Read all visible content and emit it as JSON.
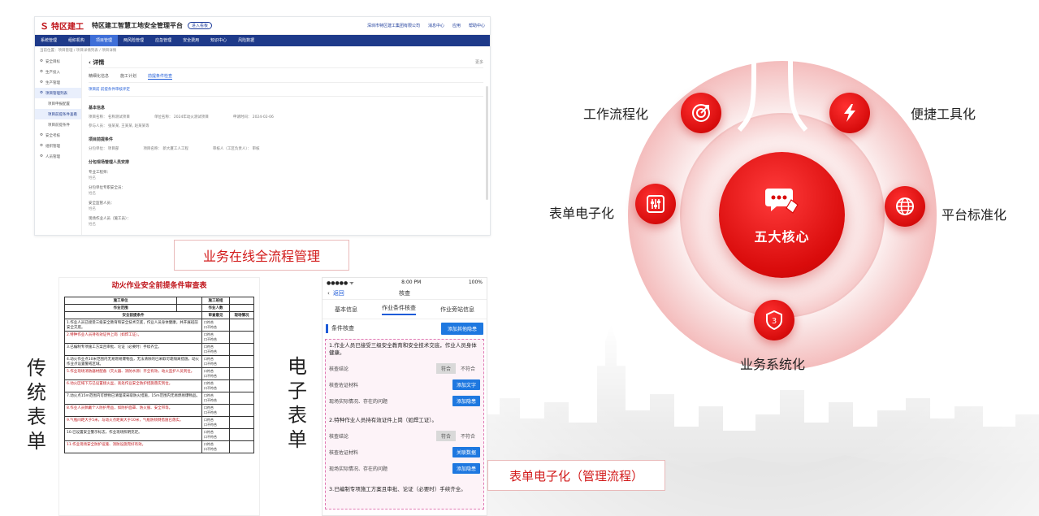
{
  "desktop": {
    "logo_text": "特区建工",
    "app_title": "特区建工智慧工地安全管理平台",
    "pill": "进入看板",
    "org": "深圳市特区建工集团有限公司",
    "top_links": [
      "消息中心",
      "应用",
      "帮助中心"
    ],
    "nav": [
      "系统管理",
      "组织机构",
      "项目管理",
      "两风险管理",
      "应急管理",
      "安全费用",
      "知识中心",
      "风险数据"
    ],
    "nav_active_index": 2,
    "breadcrumb": "当前位置：项目管理 / 项目详情列表 / 项目详情",
    "sidebar": [
      {
        "label": "安全目标",
        "sub": false
      },
      {
        "label": "生产投入",
        "sub": false
      },
      {
        "label": "生产管理",
        "sub": false
      },
      {
        "label": "项目管理列表",
        "sub": false,
        "active": true
      },
      {
        "label": "项目申报配置",
        "sub": true
      },
      {
        "label": "项目前提条件查看",
        "sub": true,
        "active_sub": true
      },
      {
        "label": "项目前提条件",
        "sub": true
      },
      {
        "label": "安全考核",
        "sub": false
      },
      {
        "label": "组织管理",
        "sub": false
      },
      {
        "label": "人员管理",
        "sub": false
      }
    ],
    "detail_title": "详情",
    "detail_more": "更多",
    "tabs": [
      "精细化信息",
      "施工计划",
      "前提条件检查"
    ],
    "tabs_active_index": 2,
    "sub_link": "项目前 前提条件审核评定",
    "section1": "基本信息",
    "row1": [
      "项目名称：   名称测试项目",
      "单位名称：   2024年动火测试项目",
      "申请时间：   2024-02-06"
    ],
    "row2": [
      "参与人员：   张某某, 王某某, 赵某某等"
    ],
    "section2": "项目前提条件",
    "row3": [
      "分包单位：   项目部",
      "项目名称：   新大厦工人工程",
      "审核人（工区负责人）：   审核"
    ],
    "section3": "分包现场管理人员安排",
    "fields": [
      {
        "label": "专业工程师：",
        "value": "姓名"
      },
      {
        "label": "分包单位专职安全员：",
        "value": "姓名"
      },
      {
        "label": "安全监管人员：",
        "value": "姓名"
      },
      {
        "label": "现场作业人员（施工员）：",
        "value": "姓名"
      }
    ]
  },
  "label_top": "业务在线全流程管理",
  "label_traditional": [
    "传",
    "统",
    "表",
    "单"
  ],
  "label_electronic": [
    "电",
    "子",
    "表",
    "单"
  ],
  "label_mobile": "表单电子化（管理流程）",
  "form": {
    "title": "动火作业安全前提条件审查表",
    "h_unit": "施工单位",
    "h_leader": "施工班组",
    "h_area": "作业范围",
    "h_people": "作业人数",
    "h_condition": "安全前提条件",
    "h_check": "审查意见",
    "h_site": "现场情况",
    "check_yes": "口符合",
    "check_no": "口不符合",
    "rows": [
      {
        "text": "1.作业人员已接受三级安全教育和安全技术交底，作业人员身体健康，并开展班前安全交底。",
        "red": false
      },
      {
        "text": "2.特种作业人员持有效证件上岗（如焊工证）。",
        "red": true
      },
      {
        "text": "3.已编制专项施工方案且审批、论证（必要时）手续齐全。",
        "red": false
      },
      {
        "text": "4.动火作业点10米范围内无易燃易爆物品，无法清除的已采取可靠隔离措施，动火作业点设置警戒区域。",
        "red": false
      },
      {
        "text": "5.作业现场消防器材配备（灭火器、消防水源）齐全有效，动火监护人员到位。",
        "red": true
      },
      {
        "text": "6.动火区域下方已设置接火盆，高处作业安全防护措施落实到位。",
        "red": true
      },
      {
        "text": "7.动火点15m范围内可燃物已清理或采取防火措施，15m范围内无易燃易爆物品。",
        "red": false
      },
      {
        "text": "8.作业人员佩戴个人防护用品，如防护面罩、防火服、安全带等。",
        "red": true
      },
      {
        "text": "9.气瓶间距大于5米，与动火点距离大于10米，气瓶防倾倒措施已落实。",
        "red": true
      },
      {
        "text": "10.已设置安全警示标志，作业现场照明充足。",
        "red": false
      },
      {
        "text": "11.作业现场安全防护设施、消防设施完好有效。",
        "red": true
      }
    ]
  },
  "mobile": {
    "carrier": "●●●●● ᯤ",
    "time": "8:00 PM",
    "battery": "100%",
    "back": "返回",
    "title": "核查",
    "tabs": [
      "基本信息",
      "作业条件核查",
      "作业旁站信息"
    ],
    "tabs_active_index": 1,
    "section": "条件核查",
    "add_btn": "添加其他隐患",
    "items": [
      {
        "question": "1.作业人员已接受三级安全教育和安全技术交底，作业人员身体健康。",
        "seg": [
          "符合",
          "不符合"
        ],
        "selected": 0,
        "lines": [
          {
            "label": "核查结论",
            "type": "seg"
          },
          {
            "label": "核查佐证材料",
            "btn": "添加文字"
          },
          {
            "label": "现场实际情况、存在的问题",
            "btn": "添加隐患"
          }
        ]
      },
      {
        "question": "2.特种作业人员持有效证件上岗（如焊工证）。",
        "seg": [
          "符合",
          "不符合"
        ],
        "selected": 0,
        "lines": [
          {
            "label": "核查结论",
            "type": "seg"
          },
          {
            "label": "核查佐证材料",
            "btn": "关联数据"
          },
          {
            "label": "现场实际情况、存在的问题",
            "btn": "添加隐患"
          }
        ]
      }
    ],
    "footer_question": "3.已编制专项施工方案且审批、论证（必要时）手续齐全。"
  },
  "diagram": {
    "center": "五大核心",
    "nodes": [
      "工作流程化",
      "便捷工具化",
      "表单电子化",
      "平台标准化",
      "业务系统化"
    ],
    "accent": "#d90b0b"
  }
}
